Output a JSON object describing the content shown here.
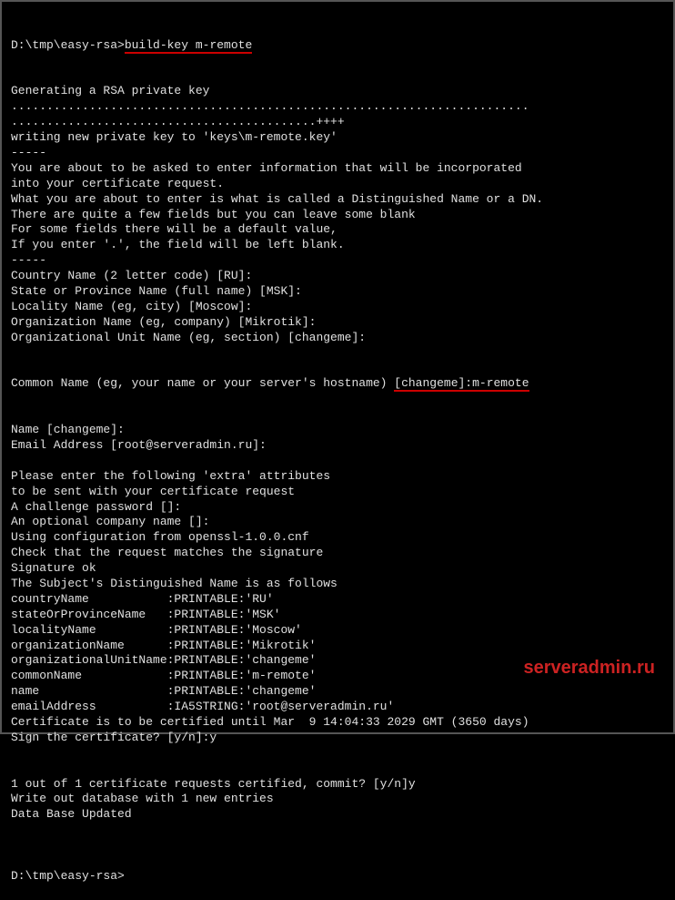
{
  "prompt1_path": "D:\\tmp\\easy-rsa>",
  "prompt1_cmd": "build-key m-remote",
  "lines": [
    "Generating a RSA private key",
    ".........................................................................",
    "...........................................++++",
    "writing new private key to 'keys\\m-remote.key'",
    "-----",
    "You are about to be asked to enter information that will be incorporated",
    "into your certificate request.",
    "What you are about to enter is what is called a Distinguished Name or a DN.",
    "There are quite a few fields but you can leave some blank",
    "For some fields there will be a default value,",
    "If you enter '.', the field will be left blank.",
    "-----",
    "Country Name (2 letter code) [RU]:",
    "State or Province Name (full name) [MSK]:",
    "Locality Name (eg, city) [Moscow]:",
    "Organization Name (eg, company) [Mikrotik]:",
    "Organizational Unit Name (eg, section) [changeme]:"
  ],
  "cn_line_prefix": "Common Name (eg, your name or your server's hostname) ",
  "cn_line_underlined": "[changeme]:m-remote",
  "lines2": [
    "Name [changeme]:",
    "Email Address [root@serveradmin.ru]:",
    "",
    "Please enter the following 'extra' attributes",
    "to be sent with your certificate request",
    "A challenge password []:",
    "An optional company name []:",
    "Using configuration from openssl-1.0.0.cnf",
    "Check that the request matches the signature",
    "Signature ok",
    "The Subject's Distinguished Name is as follows",
    "countryName           :PRINTABLE:'RU'",
    "stateOrProvinceName   :PRINTABLE:'MSK'",
    "localityName          :PRINTABLE:'Moscow'",
    "organizationName      :PRINTABLE:'Mikrotik'",
    "organizationalUnitName:PRINTABLE:'changeme'",
    "commonName            :PRINTABLE:'m-remote'",
    "name                  :PRINTABLE:'changeme'",
    "emailAddress          :IA5STRING:'root@serveradmin.ru'",
    "Certificate is to be certified until Mar  9 14:04:33 2029 GMT (3650 days)",
    "Sign the certificate? [y/n]:y",
    "",
    "",
    "1 out of 1 certificate requests certified, commit? [y/n]y",
    "Write out database with 1 new entries",
    "Data Base Updated",
    ""
  ],
  "prompt2": "D:\\tmp\\easy-rsa>",
  "watermark": "serveradmin.ru"
}
